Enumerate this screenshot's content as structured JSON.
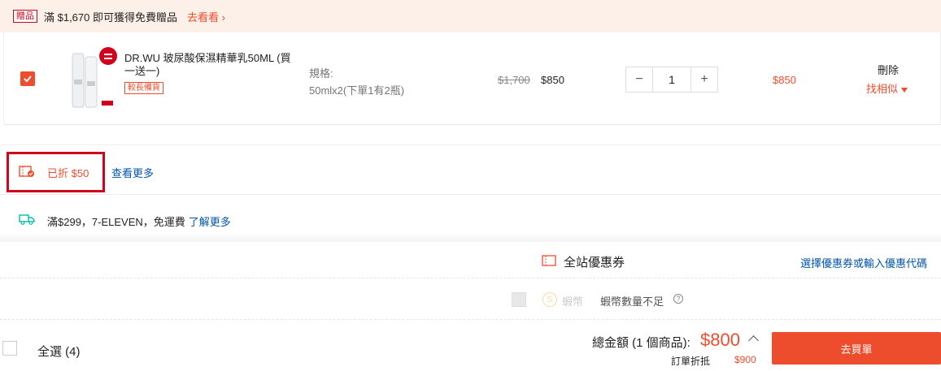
{
  "gift_banner": {
    "badge": "贈品",
    "text": "滿 $1,670 即可獲得免費贈品",
    "link": "去看看 ›"
  },
  "item": {
    "name": "DR.WU 玻尿酸保濕精華乳50ML (買一送一)",
    "stock_badge": "較長備貨",
    "variation_label": "規格:",
    "variation_value": "50mlx2(下單1有2瓶)",
    "price_original": "$1,700",
    "price_current": "$850",
    "quantity": "1",
    "qty_minus": "−",
    "qty_plus": "+",
    "subtotal": "$850",
    "delete_label": "刪除",
    "similar_label": "找相似"
  },
  "discount": {
    "text": "已折 $50",
    "see_more": "查看更多"
  },
  "shipping": {
    "text": "滿$299，7-ELEVEN，免運費",
    "link": "了解更多"
  },
  "voucher": {
    "label": "全站優惠券",
    "code_link": "選擇優惠券或輸入優惠代碼"
  },
  "coins": {
    "coin_symbol": "S",
    "label": "蝦幣",
    "insufficient": "蝦幣數量不足",
    "help": "?"
  },
  "footer": {
    "select_all": "全選 (4)",
    "total_label": "總金額 (1 個商品):",
    "total_value": "$800",
    "saved_label": "訂單折抵",
    "saved_value": "$900",
    "checkout": "去買單"
  },
  "colors": {
    "accent": "#ee4d2d",
    "link": "#0055aa",
    "highlight_box": "#d0011b"
  }
}
